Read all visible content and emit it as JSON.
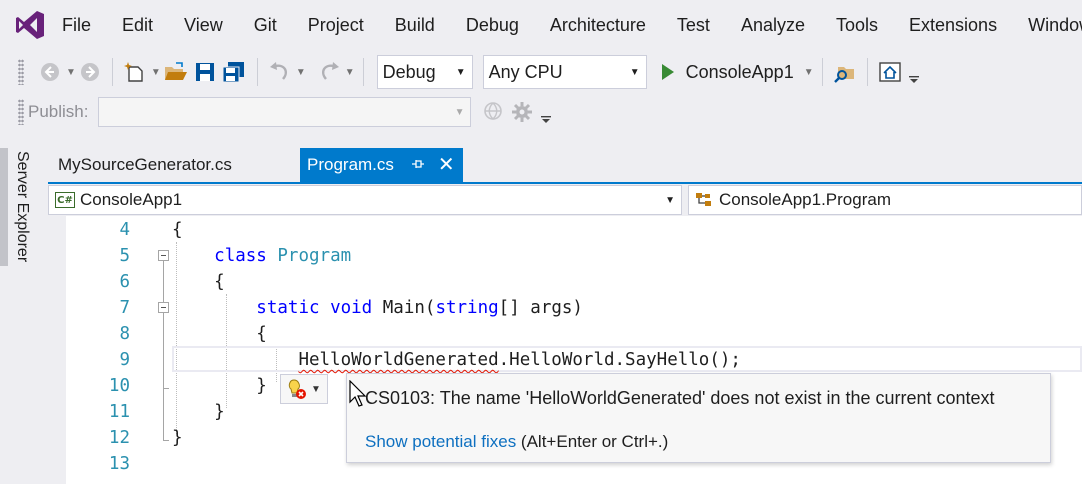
{
  "menu": [
    "File",
    "Edit",
    "View",
    "Git",
    "Project",
    "Build",
    "Debug",
    "Architecture",
    "Test",
    "Analyze",
    "Tools",
    "Extensions",
    "Window"
  ],
  "toolbar": {
    "configuration": "Debug",
    "platform": "Any CPU",
    "startup_project": "ConsoleApp1"
  },
  "publish": {
    "label": "Publish:",
    "value": ""
  },
  "side_panel": {
    "server_explorer": "Server Explorer"
  },
  "tabs": [
    {
      "label": "MySourceGenerator.cs",
      "active": false
    },
    {
      "label": "Program.cs",
      "active": true
    }
  ],
  "navbar": {
    "project_icon": "C#",
    "project": "ConsoleApp1",
    "type": "ConsoleApp1.Program"
  },
  "editor": {
    "lines": [
      {
        "num": "4"
      },
      {
        "num": "5"
      },
      {
        "num": "6"
      },
      {
        "num": "7"
      },
      {
        "num": "8"
      },
      {
        "num": "9"
      },
      {
        "num": "10"
      },
      {
        "num": "11"
      },
      {
        "num": "12"
      },
      {
        "num": "13"
      }
    ],
    "code": {
      "l4": "{",
      "l5_kw": "class",
      "l5_name": "Program",
      "l6": "{",
      "l7_static": "static",
      "l7_void": "void",
      "l7_main": "Main(",
      "l7_string": "string",
      "l7_args": "[] args)",
      "l8": "{",
      "l9_error": "HelloWorldGenerated",
      "l9_rest": ".HelloWorld.SayHello();",
      "l10": "}",
      "l11": "}",
      "l12": "}"
    }
  },
  "tooltip": {
    "message": "CS0103: The name 'HelloWorldGenerated' does not exist in the current context",
    "fix_link": "Show potential fixes",
    "fix_shortcut": " (Alt+Enter or Ctrl+.)"
  },
  "colors": {
    "accent": "#007acc",
    "keyword": "#0000ff",
    "type": "#2b91af",
    "error": "#e51400",
    "run": "#388a34",
    "logo": "#68217a"
  }
}
